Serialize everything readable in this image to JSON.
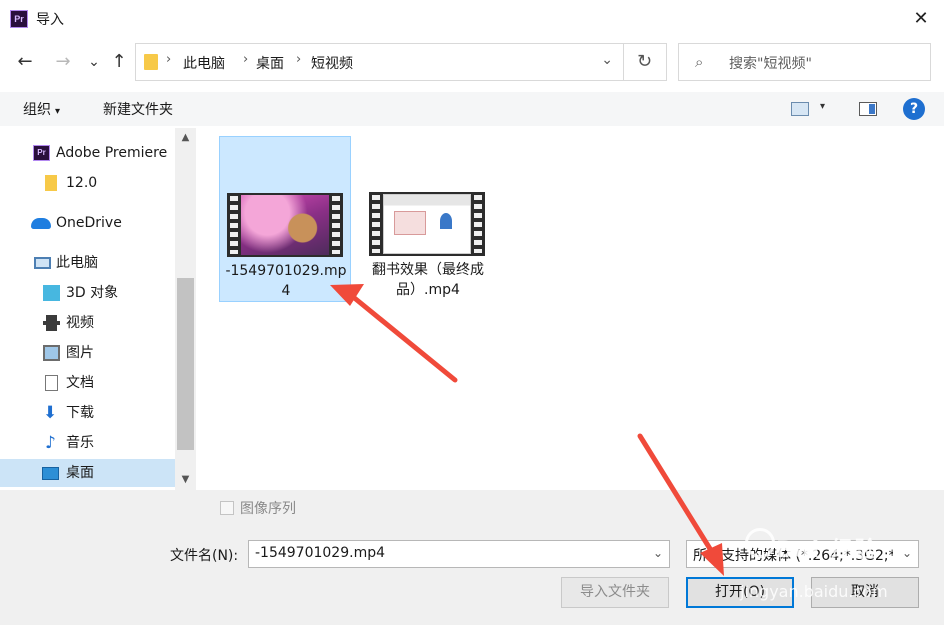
{
  "window": {
    "app_icon": "Pr",
    "title": "导入",
    "close": "✕"
  },
  "nav": {
    "back": "←",
    "forward": "→",
    "recent": "⌄",
    "up": "↑"
  },
  "address": {
    "crumbs": [
      "此电脑",
      "桌面",
      "短视频"
    ],
    "separator": "›",
    "dropdown": "⌄",
    "refresh": "↻"
  },
  "search": {
    "icon": "⌕",
    "placeholder": "搜索\"短视频\""
  },
  "commands": {
    "organize": "组织",
    "organize_caret": "▾",
    "new_folder": "新建文件夹",
    "view_caret": "▾",
    "help": "?"
  },
  "sidebar": {
    "items": [
      {
        "label": "Adobe Premiere",
        "icon": "premiere-icon"
      },
      {
        "label": "12.0",
        "icon": "folder-icon"
      },
      {
        "label": "OneDrive",
        "icon": "onedrive-icon"
      },
      {
        "label": "此电脑",
        "icon": "pc-icon"
      },
      {
        "label": "3D 对象",
        "icon": "3d-objects-icon"
      },
      {
        "label": "视频",
        "icon": "videos-icon"
      },
      {
        "label": "图片",
        "icon": "pictures-icon"
      },
      {
        "label": "文档",
        "icon": "documents-icon"
      },
      {
        "label": "下载",
        "icon": "downloads-icon"
      },
      {
        "label": "音乐",
        "icon": "music-icon"
      },
      {
        "label": "桌面",
        "icon": "desktop-icon",
        "selected": true
      }
    ],
    "scroll_up": "▲",
    "scroll_down": "▼"
  },
  "files": [
    {
      "name": "-1549701029.mp4",
      "selected": true,
      "thumbnail": "pink-blossom-video-thumbnail"
    },
    {
      "name": "翻书效果（最终成品）.mp4",
      "selected": false,
      "thumbnail": "flip-book-video-thumbnail"
    }
  ],
  "footer": {
    "sequence_label": "图像序列",
    "filename_label": "文件名(N):",
    "filename_value": "-1549701029.mp4",
    "dropdown": "⌄",
    "file_type": "所有支持的媒体 (*.264;*.3G2;*",
    "import_folder_button": "导入文件夹",
    "open_button": "打开(O)",
    "cancel_button": "取消"
  },
  "watermark": {
    "text": "Bai 经验",
    "url": "jingyan.baidu.com"
  },
  "colors": {
    "selection": "#cce8ff",
    "accent": "#0078d7",
    "arrow": "#f04a3a"
  }
}
